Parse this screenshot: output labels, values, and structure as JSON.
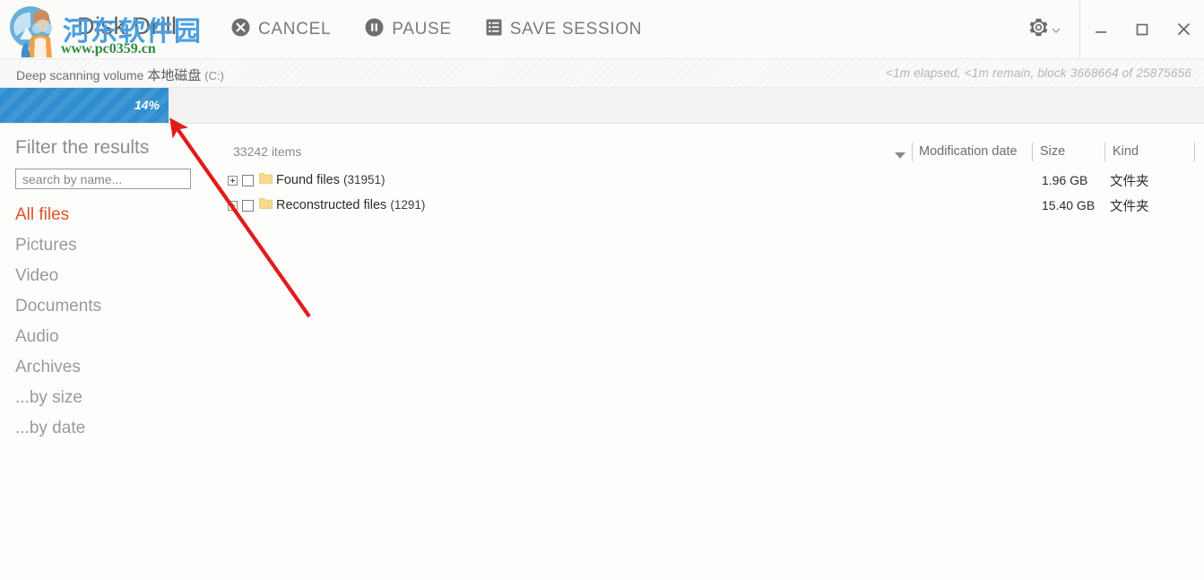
{
  "window": {
    "title": "Disk Drill",
    "controls": {
      "settings_label": "Settings",
      "minimize_label": "Minimize",
      "maximize_label": "Maximize",
      "close_label": "Close"
    }
  },
  "toolbar": {
    "actions": [
      {
        "label": "CANCEL",
        "icon": "cancel-circle-icon"
      },
      {
        "label": "PAUSE",
        "icon": "pause-circle-icon"
      },
      {
        "label": "SAVE SESSION",
        "icon": "save-session-list-icon"
      }
    ]
  },
  "status": {
    "scan_prefix": "Deep scanning volume",
    "volume_name": "本地磁盘",
    "drive_letter": "(C:)",
    "eta": "<1m elapsed,  <1m remain, block 3668664 of 25875656"
  },
  "progress": {
    "percent_label": "14%",
    "percent_value": 14,
    "bar_color": "#2f8ecf"
  },
  "sidebar": {
    "title": "Filter the results",
    "search": {
      "placeholder": "search by name...",
      "value": ""
    },
    "items": [
      {
        "label": "All files",
        "active": true
      },
      {
        "label": "Pictures",
        "active": false
      },
      {
        "label": "Video",
        "active": false
      },
      {
        "label": "Documents",
        "active": false
      },
      {
        "label": "Audio",
        "active": false
      },
      {
        "label": "Archives",
        "active": false
      },
      {
        "label": "...by size",
        "active": false
      },
      {
        "label": "...by date",
        "active": false
      }
    ],
    "active_color": "#e2502a"
  },
  "main": {
    "items_count": "33242 items",
    "columns": [
      {
        "label": "Modification date"
      },
      {
        "label": "Size"
      },
      {
        "label": "Kind"
      }
    ],
    "rows": [
      {
        "name": "Found files",
        "count": "(31951)",
        "modification_date": "",
        "size": "1.96 GB",
        "kind": "文件夹"
      },
      {
        "name": "Reconstructed files",
        "count": "(1291)",
        "modification_date": "",
        "size": "15.40 GB",
        "kind": "文件夹"
      }
    ]
  },
  "watermark": {
    "chinese": "河东软件园",
    "url": "www.pc0359.cn"
  }
}
